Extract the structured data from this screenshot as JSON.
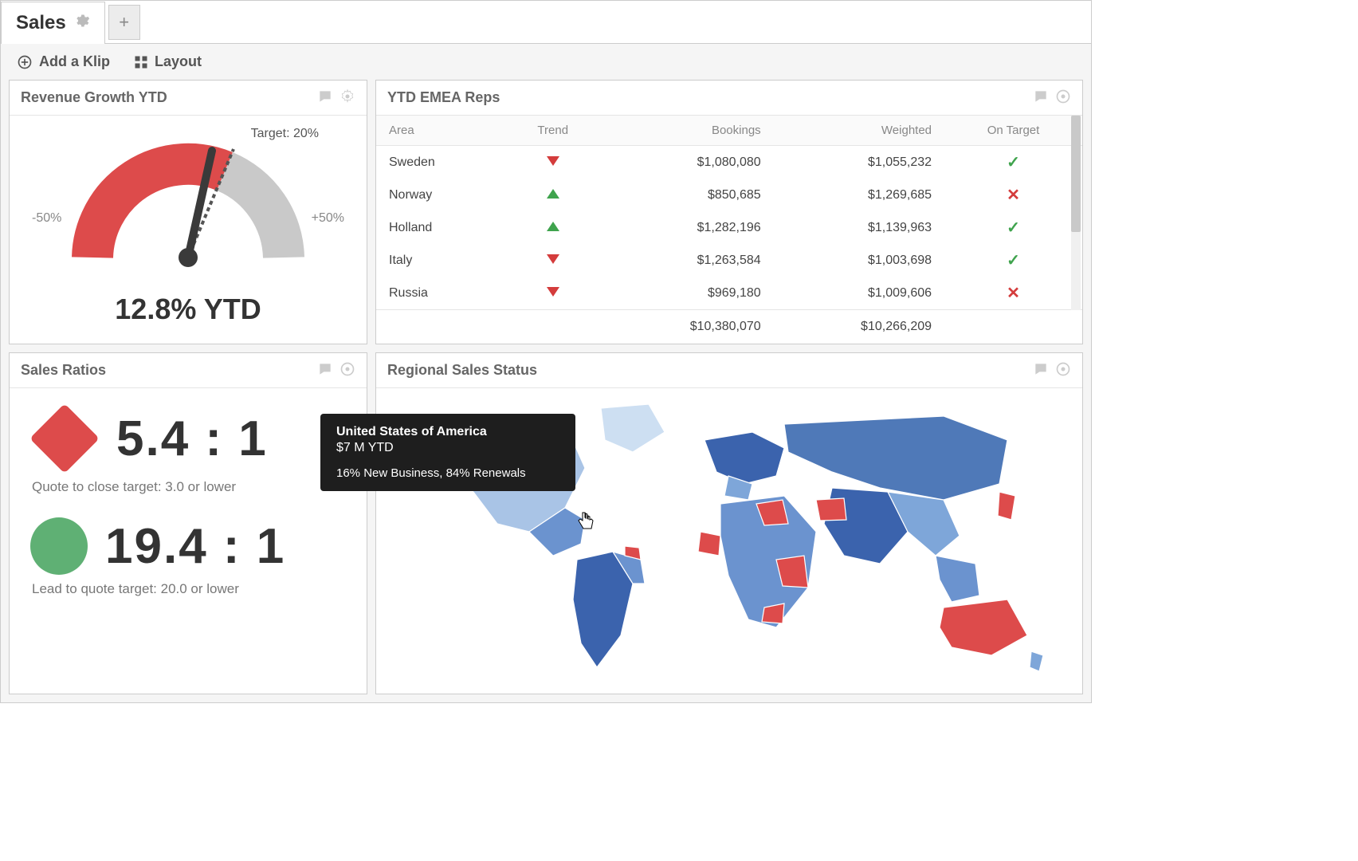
{
  "tab": {
    "label": "Sales"
  },
  "toolbar": {
    "add_klip": "Add a Klip",
    "layout": "Layout"
  },
  "revenue": {
    "title": "Revenue Growth YTD",
    "min_label": "-50%",
    "max_label": "+50%",
    "target_label": "Target: 20%",
    "value_label": "12.8% YTD"
  },
  "ratios": {
    "title": "Sales Ratios",
    "r1_value": "5.4 : 1",
    "r1_note": "Quote to close target: 3.0 or lower",
    "r2_value": "19.4 : 1",
    "r2_note": "Lead to quote target: 20.0 or lower"
  },
  "reps": {
    "title": "YTD EMEA Reps",
    "cols": {
      "area": "Area",
      "trend": "Trend",
      "bookings": "Bookings",
      "weighted": "Weighted",
      "ontarget": "On Target"
    },
    "rows": [
      {
        "area": "Sweden",
        "trend": "down",
        "bookings": "$1,080,080",
        "weighted": "$1,055,232",
        "ontarget": true
      },
      {
        "area": "Norway",
        "trend": "up",
        "bookings": "$850,685",
        "weighted": "$1,269,685",
        "ontarget": false
      },
      {
        "area": "Holland",
        "trend": "up",
        "bookings": "$1,282,196",
        "weighted": "$1,139,963",
        "ontarget": true
      },
      {
        "area": "Italy",
        "trend": "down",
        "bookings": "$1,263,584",
        "weighted": "$1,003,698",
        "ontarget": true
      },
      {
        "area": "Russia",
        "trend": "down",
        "bookings": "$969,180",
        "weighted": "$1,009,606",
        "ontarget": false
      }
    ],
    "totals": {
      "bookings": "$10,380,070",
      "weighted": "$10,266,209"
    }
  },
  "map": {
    "title": "Regional Sales Status",
    "tooltip": {
      "country": "United States of America",
      "amount": "$7 M YTD",
      "detail": "16% New Business, 84% Renewals"
    }
  },
  "chart_data": {
    "type": "gauge",
    "title": "Revenue Growth YTD",
    "value": 12.8,
    "min": -50,
    "max": 50,
    "target": 20,
    "units": "%"
  }
}
